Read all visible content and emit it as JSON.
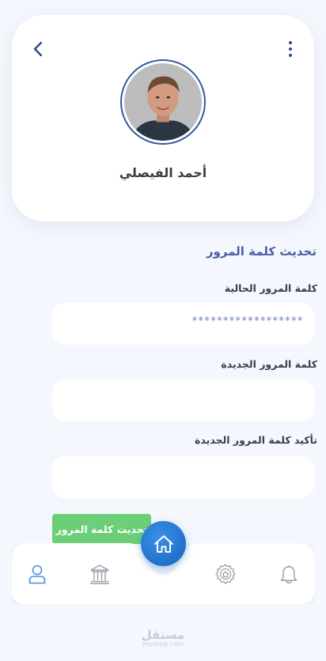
{
  "profile": {
    "name": "أحمد الفيصلي"
  },
  "section_title": "تحديث كلمة المرور",
  "fields": [
    {
      "label": "كلمة المرور الحالية",
      "value": "******************"
    },
    {
      "label": "كلمة المرور الجديدة",
      "value": ""
    },
    {
      "label": "تأكيد كلمة المرور الجديدة",
      "value": ""
    }
  ],
  "submit_label": "تحديث كلمة المرور",
  "nav": {
    "items": [
      "profile-icon",
      "bank-icon",
      "home-icon",
      "settings-icon",
      "bell-icon"
    ]
  },
  "colors": {
    "accent": "#4b5fa0",
    "fab": "#1565c0",
    "submit": "#6ccf78",
    "background": "#f4f7fd"
  },
  "watermark": {
    "main": "مستقل",
    "sub": "mostaql.com"
  }
}
